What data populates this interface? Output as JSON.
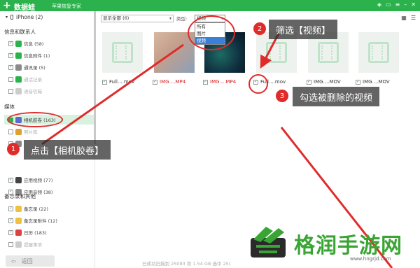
{
  "titlebar": {
    "logo_mark": "+",
    "logo_text": "数据蛙",
    "subtitle": "苹果恢复专家",
    "icons": [
      "wifi-icon",
      "chat-icon",
      "menu-icon",
      "minimize-icon",
      "close-icon"
    ]
  },
  "sidebar": {
    "device": "iPhone (2)",
    "sections": [
      "信息和联系人",
      "媒体",
      "备忘录和其他"
    ],
    "contacts_items": [
      {
        "label": "信息 (58)",
        "color": "#2bb24c"
      },
      {
        "label": "信息附件 (1)",
        "color": "#2bb24c"
      },
      {
        "label": "通讯录 (5)",
        "color": "#8a8a8a"
      },
      {
        "label": "通话记录",
        "color": "#2bb24c",
        "dim": true
      },
      {
        "label": "语音信箱",
        "color": "#cccccc",
        "dim": true
      }
    ],
    "media_items": [
      {
        "label": "相机胶卷 (163)",
        "color": "#5a6acf",
        "selected": true
      },
      {
        "label": "照片库",
        "color": "#e0a030",
        "dim": true
      },
      {
        "label": "",
        "color": "#888888",
        "dim": true
      },
      {
        "label": "应用视频 (77)",
        "color": "#444444"
      },
      {
        "label": "应用音频 (38)",
        "color": "#888888"
      }
    ],
    "memo_items": [
      {
        "label": "备忘录 (22)",
        "color": "#f0c040"
      },
      {
        "label": "备忘录附件 (12)",
        "color": "#f0c040"
      },
      {
        "label": "日历 (183)",
        "color": "#e04040"
      },
      {
        "label": "提醒事项",
        "color": "#cccccc",
        "dim": true
      }
    ],
    "back_label": "返回"
  },
  "filter": {
    "show_select": "显示全部 (6)",
    "type_label": "类型:",
    "type_value": "视频",
    "type_options": [
      "所有",
      "图片",
      "视频"
    ],
    "type_highlight_index": 2
  },
  "files": [
    {
      "name": "Full....mov",
      "kind": "generic",
      "red": false
    },
    {
      "name": "IMG....MP4",
      "kind": "photo1",
      "red": true
    },
    {
      "name": "IMG....MP4",
      "kind": "photo2",
      "red": true
    },
    {
      "name": "Full....mov",
      "kind": "generic",
      "red": false
    },
    {
      "name": "IMG....MOV",
      "kind": "generic",
      "red": false
    },
    {
      "name": "IMG....MOV",
      "kind": "generic",
      "red": false
    }
  ],
  "annotations": {
    "step1": {
      "num": "1",
      "text": "点击【相机胶卷】"
    },
    "step2": {
      "num": "2",
      "text": "筛选【视频】"
    },
    "step3": {
      "num": "3",
      "text": "勾选被删除的视频"
    },
    "accent": "#e02b2b"
  },
  "status_text": "已成功扫描到 25083 项 1.54 GB 选中 25(",
  "watermark": {
    "text": "格润手游网",
    "url": "www.hngrjd.com",
    "color": "#3aa535"
  },
  "colors": {
    "brand_green": "#2bb24c",
    "selected_bg": "#d9f2df",
    "highlight_blue": "#3b7fd6"
  }
}
